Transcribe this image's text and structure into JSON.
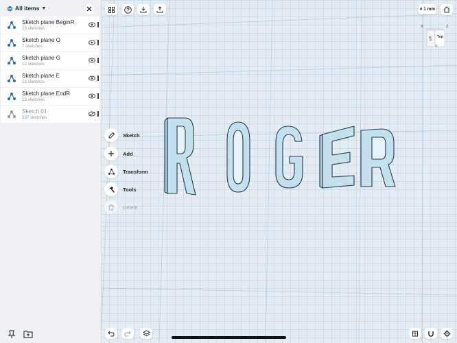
{
  "sidebar": {
    "title": "All items",
    "items": [
      {
        "name": "Sketch plane BeginR",
        "count": "13 sketches",
        "dim": false
      },
      {
        "name": "Sketch plane O",
        "count": "7 sketches",
        "dim": false
      },
      {
        "name": "Sketch plane G",
        "count": "12 sketches",
        "dim": false
      },
      {
        "name": "Sketch plane E",
        "count": "13 sketches",
        "dim": false
      },
      {
        "name": "Sketch plane EndR",
        "count": "13 sketches",
        "dim": false
      },
      {
        "name": "Sketch 01",
        "count": "337 sketches",
        "dim": true
      }
    ]
  },
  "toolbar": {
    "grid_label": "# 1 mm"
  },
  "viewcube": {
    "top_label": "Top",
    "left_label": "Left",
    "axis_x": "X",
    "axis_z": "Z",
    "axis_y": "Y"
  },
  "tools": {
    "sketch": "Sketch",
    "add": "Add",
    "transform": "Transform",
    "tools": "Tools",
    "delete": "Delete"
  },
  "colors": {
    "letter_fill": "#c5e1ef",
    "letter_stroke": "#23384a",
    "accent": "#2a6f9a"
  }
}
